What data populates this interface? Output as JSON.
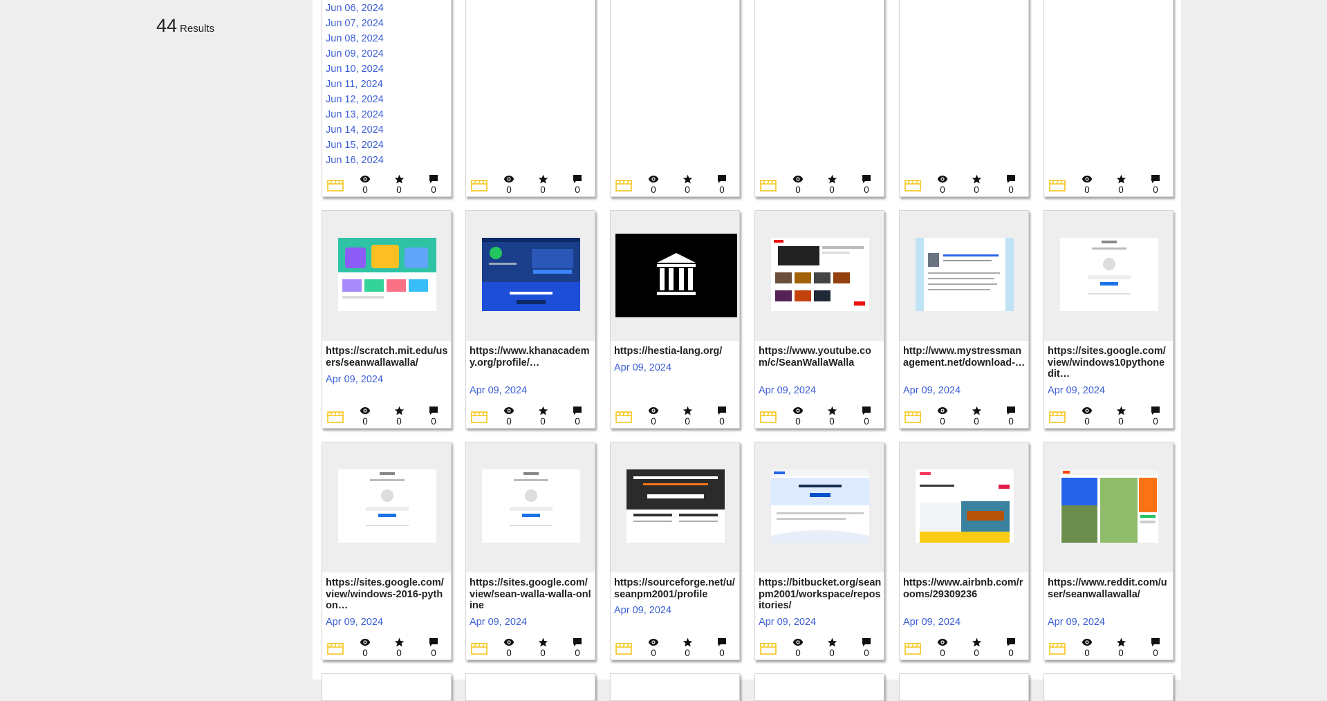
{
  "results": {
    "count": "44",
    "label": "Results"
  },
  "date_list": [
    "Jun 06, 2024",
    "Jun 07, 2024",
    "Jun 08, 2024",
    "Jun 09, 2024",
    "Jun 10, 2024",
    "Jun 11, 2024",
    "Jun 12, 2024",
    "Jun 13, 2024",
    "Jun 14, 2024",
    "Jun 15, 2024",
    "Jun 16, 2024"
  ],
  "row2": [
    {
      "url": "https://scratch.mit.edu/users/seanwallawalla/",
      "date": "Apr 09, 2024",
      "views": "0",
      "stars": "0",
      "comments": "0"
    },
    {
      "url": "https://www.khanacademy.org/profile/…",
      "date": "Apr 09, 2024",
      "views": "0",
      "stars": "0",
      "comments": "0"
    },
    {
      "url": "https://hestia-lang.org/",
      "date": "Apr 09, 2024",
      "views": "0",
      "stars": "0",
      "comments": "0"
    },
    {
      "url": "https://www.youtube.com/c/SeanWallaWalla",
      "date": "Apr 09, 2024",
      "views": "0",
      "stars": "0",
      "comments": "0"
    },
    {
      "url": "http://www.mystressmanagement.net/download-…",
      "date": "Apr 09, 2024",
      "views": "0",
      "stars": "0",
      "comments": "0"
    },
    {
      "url": "https://sites.google.com/view/windows10pythonedit…",
      "date": "Apr 09, 2024",
      "views": "0",
      "stars": "0",
      "comments": "0"
    }
  ],
  "row3": [
    {
      "url": "https://sites.google.com/view/windows-2016-python…",
      "date": "Apr 09, 2024",
      "views": "0",
      "stars": "0",
      "comments": "0"
    },
    {
      "url": "https://sites.google.com/view/sean-walla-walla-online",
      "date": "Apr 09, 2024",
      "views": "0",
      "stars": "0",
      "comments": "0"
    },
    {
      "url": "https://sourceforge.net/u/seanpm2001/profile",
      "date": "Apr 09, 2024",
      "views": "0",
      "stars": "0",
      "comments": "0"
    },
    {
      "url": "https://bitbucket.org/seanpm2001/workspace/repositories/",
      "date": "Apr 09, 2024",
      "views": "0",
      "stars": "0",
      "comments": "0"
    },
    {
      "url": "https://www.airbnb.com/rooms/29309236",
      "date": "Apr 09, 2024",
      "views": "0",
      "stars": "0",
      "comments": "0"
    },
    {
      "url": "https://www.reddit.com/user/seanwallawalla/",
      "date": "Apr 09, 2024",
      "views": "0",
      "stars": "0",
      "comments": "0"
    }
  ],
  "row1_stats": {
    "views": "0",
    "stars": "0",
    "comments": "0"
  },
  "colors": {
    "accent": "#3b5ed6",
    "badge": "#f5c518"
  }
}
